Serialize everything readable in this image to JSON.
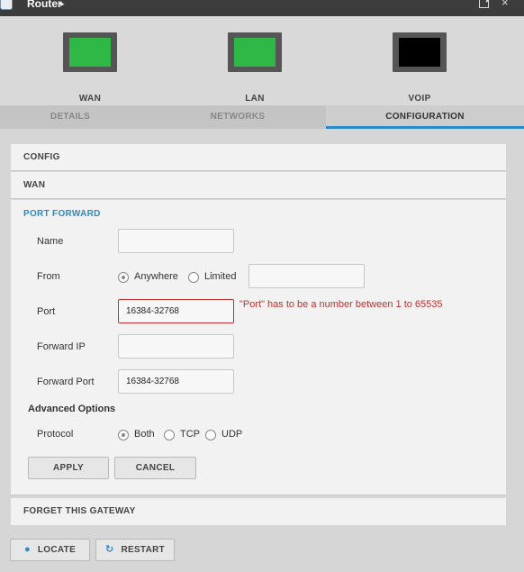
{
  "window": {
    "title": "Router",
    "title_caret": "▸",
    "popout_icon": "popout-icon",
    "close_icon": "×"
  },
  "ports": [
    {
      "label": "WAN",
      "color": "#2fb845"
    },
    {
      "label": "LAN",
      "color": "#2fb845"
    },
    {
      "label": "VOIP",
      "color": "#000000"
    }
  ],
  "tabs": [
    {
      "label": "DETAILS"
    },
    {
      "label": "NETWORKS"
    },
    {
      "label": "CONFIGURATION",
      "active": true
    }
  ],
  "sections": {
    "config": "CONFIG",
    "wan": "WAN",
    "port_forward": "PORT FORWARD",
    "forget": "FORGET THIS GATEWAY"
  },
  "form": {
    "name_label": "Name",
    "name_value": "",
    "from_label": "From",
    "from_anywhere": "Anywhere",
    "from_limited": "Limited",
    "from_selected": "Anywhere",
    "limited_value": "",
    "port_label": "Port",
    "port_value": "16384-32768",
    "port_error": "\"Port\" has to be a number between 1 to 65535",
    "forward_ip_label": "Forward IP",
    "forward_ip_value": "",
    "forward_port_label": "Forward Port",
    "forward_port_value": "16384-32768",
    "advanced_label": "Advanced Options",
    "protocol_label": "Protocol",
    "protocol_both": "Both",
    "protocol_tcp": "TCP",
    "protocol_udp": "UDP",
    "protocol_selected": "Both",
    "apply_label": "APPLY",
    "cancel_label": "CANCEL"
  },
  "footer": {
    "locate_label": "LOCATE",
    "restart_label": "RESTART",
    "locate_icon": "map-pin-icon",
    "restart_icon": "refresh-icon"
  },
  "colors": {
    "accent": "#2a89c7",
    "error": "#c0302d",
    "port_active": "#2fb845"
  }
}
